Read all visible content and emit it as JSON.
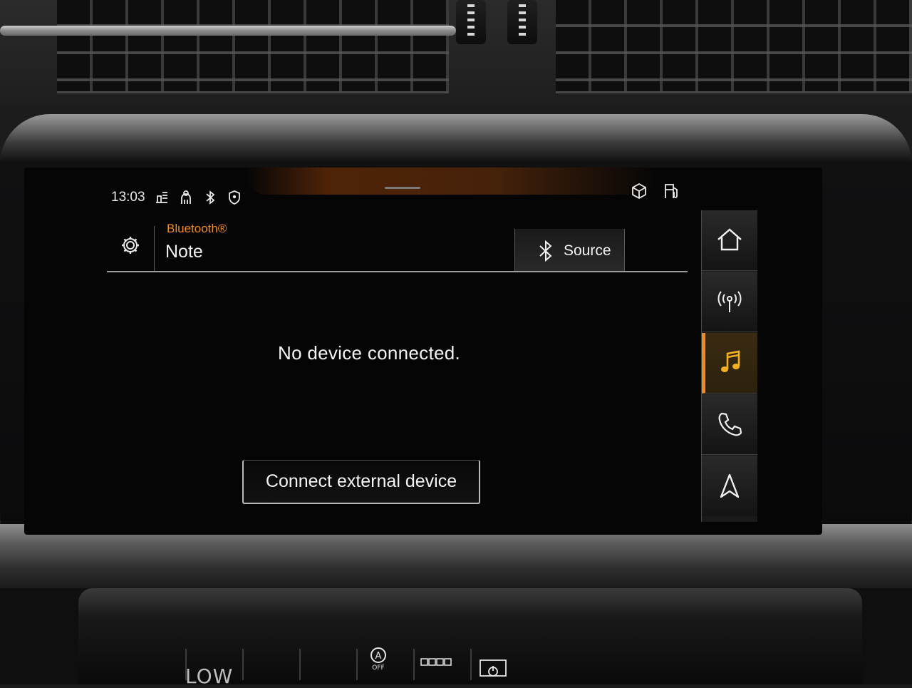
{
  "status_bar": {
    "time": "13:03",
    "left_icons": [
      "traffic-sign-icon",
      "person-icon",
      "bluetooth-icon",
      "location-shield-icon"
    ],
    "right_icons": [
      "package-icon",
      "fuel-icon"
    ]
  },
  "header": {
    "subtitle": "Bluetooth®",
    "title": "Note",
    "source_label": "Source"
  },
  "main": {
    "message": "No device connected.",
    "connect_button_label": "Connect external device"
  },
  "nav": {
    "items": [
      {
        "icon": "home-icon",
        "active": false
      },
      {
        "icon": "radio-icon",
        "active": false
      },
      {
        "icon": "music-icon",
        "active": true
      },
      {
        "icon": "phone-icon",
        "active": false
      },
      {
        "icon": "navigation-icon",
        "active": false
      }
    ]
  },
  "console": {
    "auto_off_label": "OFF",
    "partial_text": "LOW"
  },
  "colors": {
    "accent": "#f08a24",
    "text": "#f4f4f4",
    "screen_bg": "#050506"
  }
}
